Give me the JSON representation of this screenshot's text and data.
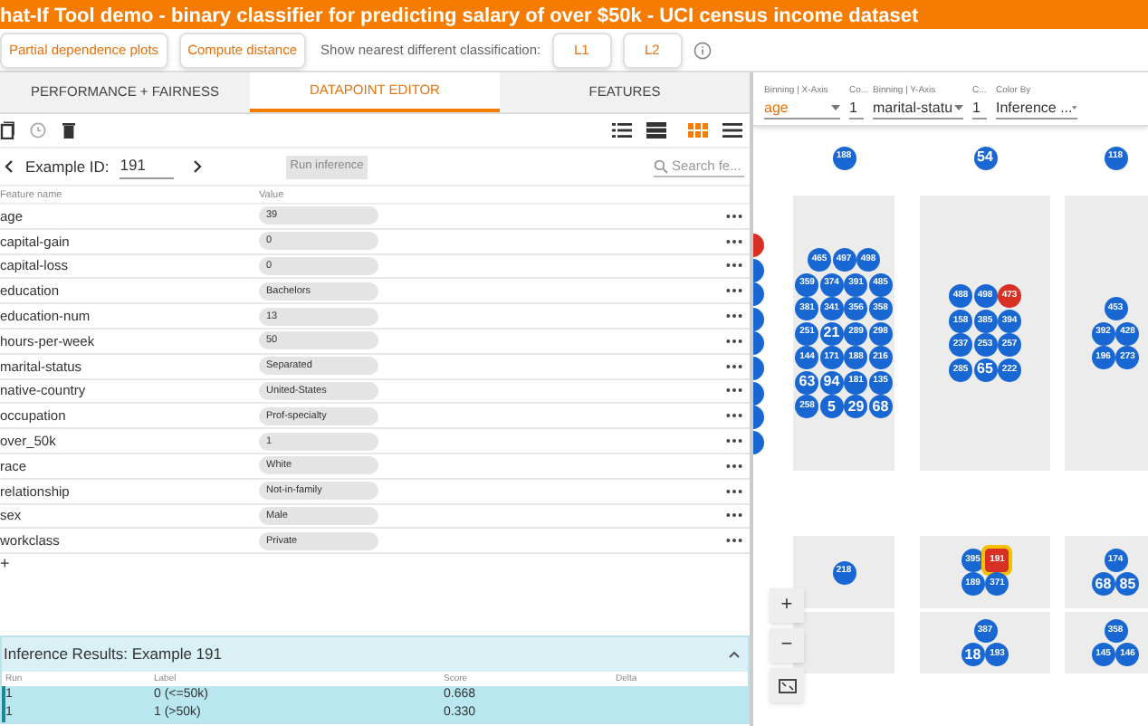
{
  "title_bar": {
    "title": "hat-If Tool demo - binary classifier for predicting salary of over $50k - UCI census income dataset"
  },
  "actions": {
    "buttons": [
      "Partial dependence plots",
      "Compute distance"
    ],
    "nearest_label": "Show nearest different classification:",
    "distance_buttons": [
      "L1",
      "L2"
    ]
  },
  "tabs": [
    {
      "label": "PERFORMANCE + FAIRNESS",
      "selected": false
    },
    {
      "label": "DATAPOINT EDITOR",
      "selected": true
    },
    {
      "label": "FEATURES",
      "selected": false
    }
  ],
  "view_modes": [
    {
      "selected": false
    },
    {
      "selected": false
    },
    {
      "selected": true
    },
    {
      "selected": false
    }
  ],
  "example": {
    "label": "Example ID:",
    "id": "191",
    "run_button": "Run inference",
    "search_placeholder": "Search fe..."
  },
  "features": {
    "columns": [
      "Feature name",
      "Value"
    ],
    "rows": [
      {
        "name": "age",
        "value": "39"
      },
      {
        "name": "capital-gain",
        "value": "0"
      },
      {
        "name": "capital-loss",
        "value": "0"
      },
      {
        "name": "education",
        "value": "Bachelors"
      },
      {
        "name": "education-num",
        "value": "13"
      },
      {
        "name": "hours-per-week",
        "value": "50"
      },
      {
        "name": "marital-status",
        "value": "Separated"
      },
      {
        "name": "native-country",
        "value": "United-States"
      },
      {
        "name": "occupation",
        "value": "Prof-specialty"
      },
      {
        "name": "over_50k",
        "value": "1"
      },
      {
        "name": "race",
        "value": "White"
      },
      {
        "name": "relationship",
        "value": "Not-in-family"
      },
      {
        "name": "sex",
        "value": "Male"
      },
      {
        "name": "workclass",
        "value": "Private"
      }
    ],
    "add": "+"
  },
  "inference": {
    "title": "Inference Results: Example 191",
    "columns": [
      "Run",
      "Label",
      "Score",
      "Delta"
    ],
    "rows": [
      {
        "run": "1",
        "label": "0 (<=50k)",
        "score": "0.668"
      },
      {
        "run": "1",
        "label": "1 (>50k)",
        "score": "0.330"
      }
    ]
  },
  "controls": [
    {
      "label": "Binning | X-Axis",
      "value": "age",
      "dropdown": true
    },
    {
      "label": "Co...",
      "value": "1",
      "dropdown": false
    },
    {
      "label": "Binning | Y-Axis",
      "value": "marital-statu",
      "dropdown": true
    },
    {
      "label": "C...",
      "value": "1",
      "dropdown": false
    },
    {
      "label": "Color By",
      "value": "Inference ...",
      "dropdown": true
    }
  ],
  "scatter": {
    "edge_dots": [
      {
        "color": "#d93025"
      },
      {
        "color": "#1967d2"
      },
      {
        "color": "#1967d2"
      },
      {
        "color": "#1967d2"
      },
      {
        "color": "#1967d2"
      },
      {
        "color": "#1967d2"
      },
      {
        "color": "#1967d2"
      },
      {
        "color": "#1967d2"
      },
      {
        "color": "#1967d2"
      }
    ],
    "bin_rows": [
      {
        "bins": [
          {
            "rows": [
              [
                {
                  "label": "188",
                  "color": "#1967d2",
                  "selected": false
                }
              ]
            ]
          },
          {
            "rows": [
              [
                {
                  "label": "54",
                  "color": "#1967d2",
                  "selected": false
                }
              ]
            ]
          },
          {
            "rows": [
              [
                {
                  "label": "118",
                  "color": "#1967d2",
                  "selected": false
                }
              ]
            ]
          }
        ]
      },
      {
        "bins": [
          {
            "rows": [
              [
                {
                  "label": "465",
                  "color": "#1967d2",
                  "selected": false
                },
                {
                  "label": "497",
                  "color": "#1967d2",
                  "selected": false
                },
                {
                  "label": "498",
                  "color": "#1967d2",
                  "selected": false
                }
              ],
              [
                {
                  "label": "359",
                  "color": "#1967d2",
                  "selected": false
                },
                {
                  "label": "374",
                  "color": "#1967d2",
                  "selected": false
                },
                {
                  "label": "391",
                  "color": "#1967d2",
                  "selected": false
                },
                {
                  "label": "485",
                  "color": "#1967d2",
                  "selected": false
                }
              ],
              [
                {
                  "label": "381",
                  "color": "#1967d2",
                  "selected": false
                },
                {
                  "label": "341",
                  "color": "#1967d2",
                  "selected": false
                },
                {
                  "label": "356",
                  "color": "#1967d2",
                  "selected": false
                },
                {
                  "label": "358",
                  "color": "#1967d2",
                  "selected": false
                }
              ],
              [
                {
                  "label": "251",
                  "color": "#1967d2",
                  "selected": false
                },
                {
                  "label": "21",
                  "color": "#1967d2",
                  "selected": false
                },
                {
                  "label": "289",
                  "color": "#1967d2",
                  "selected": false
                },
                {
                  "label": "298",
                  "color": "#1967d2",
                  "selected": false
                }
              ],
              [
                {
                  "label": "144",
                  "color": "#1967d2",
                  "selected": false
                },
                {
                  "label": "171",
                  "color": "#1967d2",
                  "selected": false
                },
                {
                  "label": "188",
                  "color": "#1967d2",
                  "selected": false
                },
                {
                  "label": "216",
                  "color": "#1967d2",
                  "selected": false
                }
              ],
              [
                {
                  "label": "63",
                  "color": "#1967d2",
                  "selected": false
                },
                {
                  "label": "94",
                  "color": "#1967d2",
                  "selected": false
                },
                {
                  "label": "181",
                  "color": "#1967d2",
                  "selected": false
                },
                {
                  "label": "135",
                  "color": "#1967d2",
                  "selected": false
                }
              ],
              [
                {
                  "label": "258",
                  "color": "#1967d2",
                  "selected": false
                },
                {
                  "label": "5",
                  "color": "#1967d2",
                  "selected": false
                },
                {
                  "label": "29",
                  "color": "#1967d2",
                  "selected": false
                },
                {
                  "label": "68",
                  "color": "#1967d2",
                  "selected": false
                }
              ]
            ]
          },
          {
            "rows": [
              [
                {
                  "label": "488",
                  "color": "#1967d2",
                  "selected": false
                },
                {
                  "label": "498",
                  "color": "#1967d2",
                  "selected": false
                },
                {
                  "label": "473",
                  "color": "#d93025",
                  "selected": false
                }
              ],
              [
                {
                  "label": "158",
                  "color": "#1967d2",
                  "selected": false
                },
                {
                  "label": "385",
                  "color": "#1967d2",
                  "selected": false
                },
                {
                  "label": "394",
                  "color": "#1967d2",
                  "selected": false
                }
              ],
              [
                {
                  "label": "237",
                  "color": "#1967d2",
                  "selected": false
                },
                {
                  "label": "253",
                  "color": "#1967d2",
                  "selected": false
                },
                {
                  "label": "257",
                  "color": "#1967d2",
                  "selected": false
                }
              ],
              [
                {
                  "label": "285",
                  "color": "#1967d2",
                  "selected": false
                },
                {
                  "label": "65",
                  "color": "#1967d2",
                  "selected": false
                },
                {
                  "label": "222",
                  "color": "#1967d2",
                  "selected": false
                }
              ]
            ]
          },
          {
            "rows": [
              [
                {
                  "label": "453",
                  "color": "#1967d2",
                  "selected": false
                }
              ],
              [
                {
                  "label": "392",
                  "color": "#1967d2",
                  "selected": false
                },
                {
                  "label": "428",
                  "color": "#1967d2",
                  "selected": false
                }
              ],
              [
                {
                  "label": "196",
                  "color": "#1967d2",
                  "selected": false
                },
                {
                  "label": "273",
                  "color": "#1967d2",
                  "selected": false
                }
              ]
            ]
          }
        ]
      },
      {
        "bins": [
          {
            "rows": [
              [
                {
                  "label": "218",
                  "color": "#1967d2",
                  "selected": false
                }
              ]
            ]
          },
          {
            "rows": [
              [
                {
                  "label": "395",
                  "color": "#1967d2",
                  "selected": false
                },
                {
                  "label": "191",
                  "color": "#d93025",
                  "selected": true
                }
              ],
              [
                {
                  "label": "189",
                  "color": "#1967d2",
                  "selected": false
                },
                {
                  "label": "371",
                  "color": "#1967d2",
                  "selected": false
                }
              ]
            ]
          },
          {
            "rows": [
              [
                {
                  "label": "174",
                  "color": "#1967d2",
                  "selected": false
                }
              ],
              [
                {
                  "label": "68",
                  "color": "#1967d2",
                  "selected": false
                },
                {
                  "label": "85",
                  "color": "#1967d2",
                  "selected": false
                }
              ]
            ]
          }
        ]
      },
      {
        "bins": [
          {
            "rows": [
              [
                {
                  "label": "387",
                  "color": "#1967d2",
                  "selected": false
                }
              ],
              [
                {
                  "label": "18",
                  "color": "#1967d2",
                  "selected": false
                },
                {
                  "label": "193",
                  "color": "#1967d2",
                  "selected": false
                }
              ]
            ]
          },
          {
            "rows": [
              [
                {
                  "label": "358",
                  "color": "#1967d2",
                  "selected": false
                }
              ],
              [
                {
                  "label": "145",
                  "color": "#1967d2",
                  "selected": false
                },
                {
                  "label": "146",
                  "color": "#1967d2",
                  "selected": false
                }
              ]
            ]
          }
        ]
      }
    ]
  },
  "zoom_controls": [
    "+",
    "−"
  ]
}
